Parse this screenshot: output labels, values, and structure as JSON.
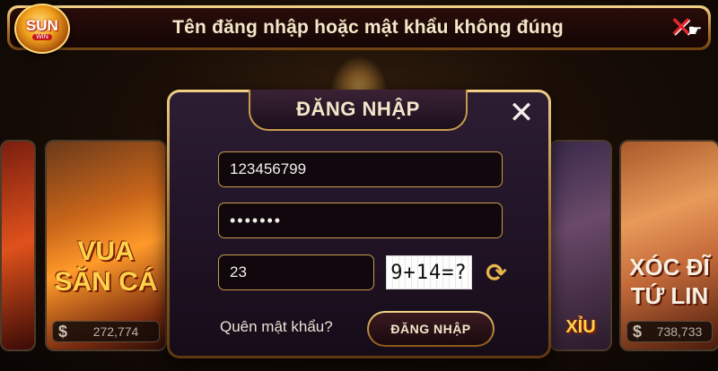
{
  "notification": {
    "message": "Tên đăng nhập hoặc mật khẩu không đúng"
  },
  "logo": {
    "text": "SUN",
    "sub": "WIN",
    "icon": "sunwin-logo"
  },
  "top_close": {
    "icon": "close-x-with-hand-cursor-icon"
  },
  "background": {
    "games": [
      {
        "title": "VUA SĂN CÁ",
        "jackpot": "272,774"
      },
      {
        "title": "XỈU",
        "jackpot": ""
      },
      {
        "title": "XÓC ĐĨ TỨ LIN",
        "jackpot": "738,733"
      }
    ]
  },
  "login": {
    "title": "ĐĂNG NHẬP",
    "close_icon": "close-icon",
    "username": {
      "value": "123456799"
    },
    "password": {
      "value": "•••••••"
    },
    "captcha": {
      "value": "23",
      "image_text": "9+14=?",
      "refresh_icon": "refresh-icon"
    },
    "forgot_password": "Quên mật khẩu?",
    "submit_label": "ĐĂNG NHẬP"
  },
  "colors": {
    "gold": "#c89a4c",
    "text_light": "#f3e7c9",
    "panel": "#231528",
    "error_x": "#e2242a"
  }
}
